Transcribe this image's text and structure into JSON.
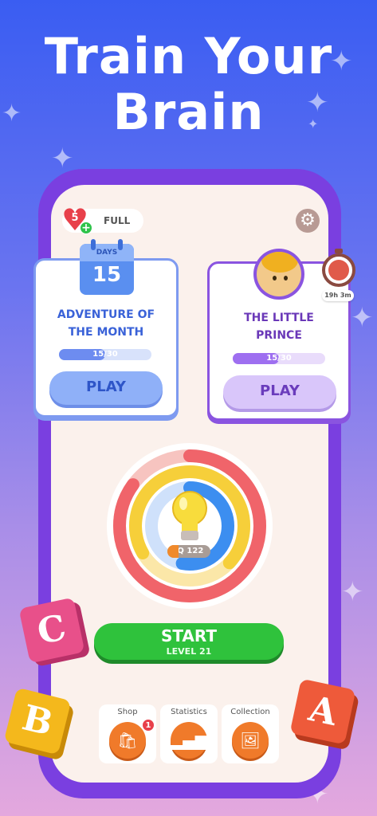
{
  "headline": {
    "line1": "Train Your",
    "line2": "Brain"
  },
  "top_bar": {
    "lives_count": "5",
    "lives_status": "FULL"
  },
  "cards": [
    {
      "calendar_label": "DAYS",
      "calendar_number": "15",
      "title_line1": "ADVENTURE OF",
      "title_line2": "THE MONTH",
      "progress_text": "15/30",
      "progress_fraction": 0.5,
      "button": "PLAY"
    },
    {
      "title_line1": "THE LITTLE",
      "title_line2": "PRINCE",
      "timer": "19h 3m",
      "progress_text": "15/30",
      "progress_fraction": 0.5,
      "button": "PLAY"
    }
  ],
  "brain": {
    "iq": "IQ 122"
  },
  "start": {
    "label": "START",
    "level": "LEVEL 21"
  },
  "menu": [
    {
      "label": "Shop",
      "icon": "shop-bag-icon",
      "badge": "1"
    },
    {
      "label": "Statistics",
      "icon": "bar-chart-icon"
    },
    {
      "label": "Collection",
      "icon": "photos-icon"
    }
  ],
  "blocks": [
    "C",
    "B",
    "A"
  ],
  "colors": {
    "play_blue": "#8fb0f8",
    "play_purple": "#d9c6fa",
    "start_green": "#2fc23c",
    "menu_orange": "#f07a2a"
  }
}
